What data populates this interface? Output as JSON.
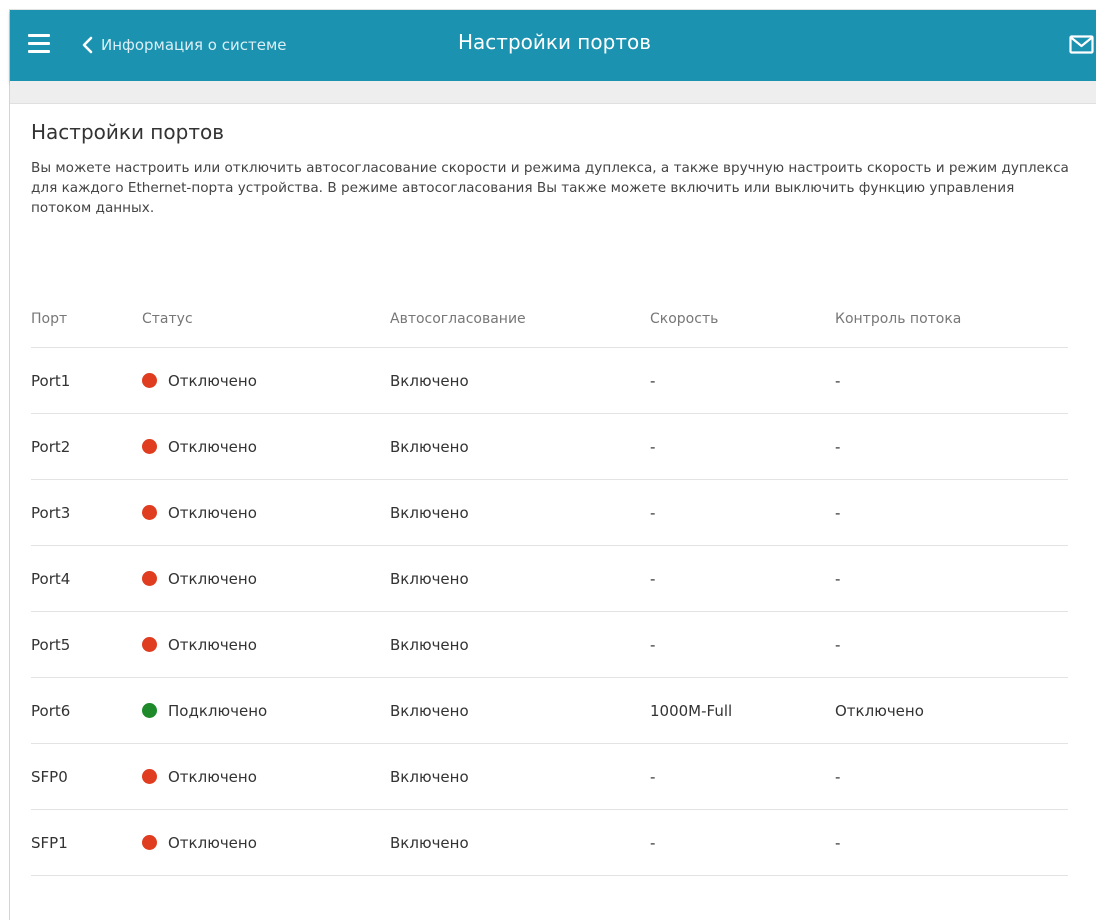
{
  "header": {
    "back_label": "Информация о системе",
    "title": "Настройки портов"
  },
  "page": {
    "heading": "Настройки портов",
    "description": "Вы можете настроить или отключить автосогласование скорости и режима дуплекса, а также вручную настроить скорость и режим дуплекса для каждого Ethernet-порта устройства. В режиме автосогласования Вы также можете включить или выключить функцию управления потоком данных."
  },
  "table": {
    "columns": [
      "Порт",
      "Статус",
      "Автосогласование",
      "Скорость",
      "Контроль потока"
    ],
    "rows": [
      {
        "port": "Port1",
        "status": "Отключено",
        "autoneg": "Включено",
        "speed": "-",
        "flow": "-"
      },
      {
        "port": "Port2",
        "status": "Отключено",
        "autoneg": "Включено",
        "speed": "-",
        "flow": "-"
      },
      {
        "port": "Port3",
        "status": "Отключено",
        "autoneg": "Включено",
        "speed": "-",
        "flow": "-"
      },
      {
        "port": "Port4",
        "status": "Отключено",
        "autoneg": "Включено",
        "speed": "-",
        "flow": "-"
      },
      {
        "port": "Port5",
        "status": "Отключено",
        "autoneg": "Включено",
        "speed": "-",
        "flow": "-"
      },
      {
        "port": "Port6",
        "status": "Подключено",
        "autoneg": "Включено",
        "speed": "1000M-Full",
        "flow": "Отключено"
      },
      {
        "port": "SFP0",
        "status": "Отключено",
        "autoneg": "Включено",
        "speed": "-",
        "flow": "-"
      },
      {
        "port": "SFP1",
        "status": "Отключено",
        "autoneg": "Включено",
        "speed": "-",
        "flow": "-"
      }
    ]
  },
  "colors": {
    "header_bg": "#1a92b0",
    "status_connected": "#1e8a2a",
    "status_disconnected": "#e03c1f"
  },
  "icons": {
    "menu": "hamburger-menu-icon",
    "back": "chevron-left-icon",
    "mail": "envelope-icon",
    "status": "status-dot-icon"
  }
}
